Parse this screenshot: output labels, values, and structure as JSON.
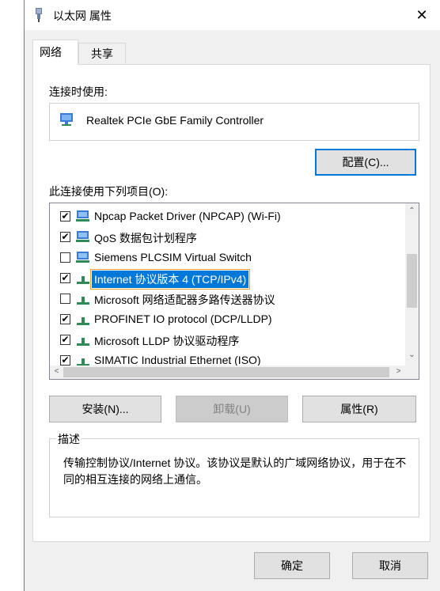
{
  "window": {
    "title": "以太网 属性",
    "close_symbol": "✕"
  },
  "tabs": [
    {
      "label": "网络",
      "active": true
    },
    {
      "label": "共享",
      "active": false
    }
  ],
  "connect_using": {
    "label": "连接时使用:",
    "adapter_name": "Realtek PCIe GbE Family Controller",
    "configure_button": "配置(C)..."
  },
  "items_section": {
    "label": "此连接使用下列项目(O):",
    "items": [
      {
        "checked": true,
        "icon": "network-client-icon",
        "label": "Npcap Packet Driver (NPCAP) (Wi-Fi)",
        "selected": false
      },
      {
        "checked": true,
        "icon": "network-client-icon",
        "label": "QoS 数据包计划程序",
        "selected": false
      },
      {
        "checked": false,
        "icon": "network-client-icon",
        "label": "Siemens PLCSIM Virtual Switch",
        "selected": false
      },
      {
        "checked": true,
        "icon": "network-protocol-icon",
        "label": "Internet 协议版本 4 (TCP/IPv4)",
        "selected": true
      },
      {
        "checked": false,
        "icon": "network-protocol-icon",
        "label": "Microsoft 网络适配器多路传送器协议",
        "selected": false
      },
      {
        "checked": true,
        "icon": "network-protocol-icon",
        "label": "PROFINET IO protocol (DCP/LLDP)",
        "selected": false
      },
      {
        "checked": true,
        "icon": "network-protocol-icon",
        "label": "Microsoft LLDP 协议驱动程序",
        "selected": false
      },
      {
        "checked": true,
        "icon": "network-protocol-icon",
        "label": "SIMATIC Industrial Ethernet (ISO)",
        "selected": false
      }
    ]
  },
  "item_buttons": {
    "install": "安装(N)...",
    "uninstall": "卸载(U)",
    "properties": "属性(R)"
  },
  "description": {
    "legend": "描述",
    "text": "传输控制协议/Internet 协议。该协议是默认的广域网络协议，用于在不同的相互连接的网络上通信。"
  },
  "footer": {
    "ok": "确定",
    "cancel": "取消"
  },
  "colors": {
    "accent": "#0078d7",
    "focus_outline": "#f0a030",
    "window_bg": "#f0f0f0"
  }
}
